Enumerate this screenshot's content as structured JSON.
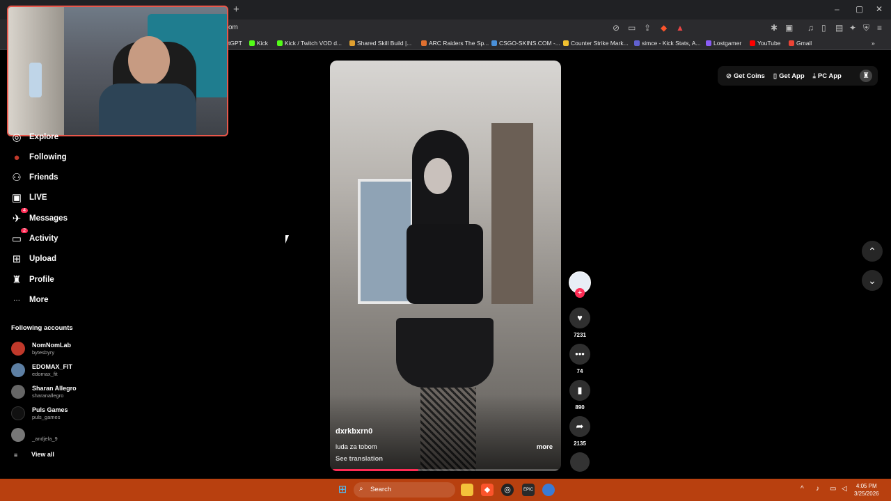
{
  "browser": {
    "new_tab": "+",
    "url": "om",
    "window": {
      "minimize": "–",
      "maximize": "▢",
      "close": "✕"
    },
    "bookmarks": [
      {
        "label": "tGPT",
        "color": "#2b2b2e"
      },
      {
        "label": "Kick",
        "color": "#53fc18"
      },
      {
        "label": "Kick / Twitch VOD d...",
        "color": "#53fc18"
      },
      {
        "label": "Shared Skill Build |...",
        "color": "#e0a030"
      },
      {
        "label": "ARC Raiders The Sp...",
        "color": "#e07030"
      },
      {
        "label": "CSGO-SKINS.COM -...",
        "color": "#4a90d9"
      },
      {
        "label": "Counter Strike Mark...",
        "color": "#f0c030"
      },
      {
        "label": "simce - Kick Stats, A...",
        "color": "#6060d0"
      },
      {
        "label": "Lostgamer",
        "color": "#8a5cf5"
      },
      {
        "label": "YouTube",
        "color": "#ff0000"
      },
      {
        "label": "Gmail",
        "color": "#ea4335"
      }
    ]
  },
  "sidebar": {
    "items": [
      {
        "label": "Explore",
        "icon": "compass-icon",
        "glyph": "◎"
      },
      {
        "label": "Following",
        "icon": "following-avatar-icon",
        "glyph": "●"
      },
      {
        "label": "Friends",
        "icon": "friends-icon",
        "glyph": "⚇"
      },
      {
        "label": "LIVE",
        "icon": "live-icon",
        "glyph": "▣"
      },
      {
        "label": "Messages",
        "icon": "messages-icon",
        "glyph": "✈",
        "badge": "4"
      },
      {
        "label": "Activity",
        "icon": "activity-icon",
        "glyph": "▭",
        "badge": "2"
      },
      {
        "label": "Upload",
        "icon": "upload-icon",
        "glyph": "⊞"
      },
      {
        "label": "Profile",
        "icon": "profile-icon",
        "glyph": "♜"
      },
      {
        "label": "More",
        "icon": "more-icon",
        "glyph": "···"
      }
    ],
    "following_title": "Following accounts",
    "accounts": [
      {
        "name": "NomNomLab",
        "handle": "bytesbyry",
        "color": "#c0392b"
      },
      {
        "name": "EDOMAX_FIT",
        "handle": "edomax_fit",
        "color": "#5d7fa3"
      },
      {
        "name": "Sharan Allegro",
        "handle": "sharanallegro",
        "color": "#666"
      },
      {
        "name": "Puls Games",
        "handle": "puls_games",
        "color": "#111"
      },
      {
        "name": "",
        "handle": "_andjela_9",
        "color": "#777"
      }
    ],
    "view_all": "View all",
    "view_all_icon": "≡"
  },
  "video": {
    "author": "dxrkbxrn0",
    "description": "luda za tobom",
    "more": "more",
    "see_translation": "See translation",
    "progress": 0.38
  },
  "actions": {
    "likes": "7231",
    "comments": "74",
    "saves": "890",
    "shares": "2135"
  },
  "header_actions": {
    "get_coins": "Get Coins",
    "get_app": "Get App",
    "pc_app": "PC App"
  },
  "taskbar": {
    "search": "Search",
    "time": "4:05 PM",
    "date": "3/25/2026"
  }
}
